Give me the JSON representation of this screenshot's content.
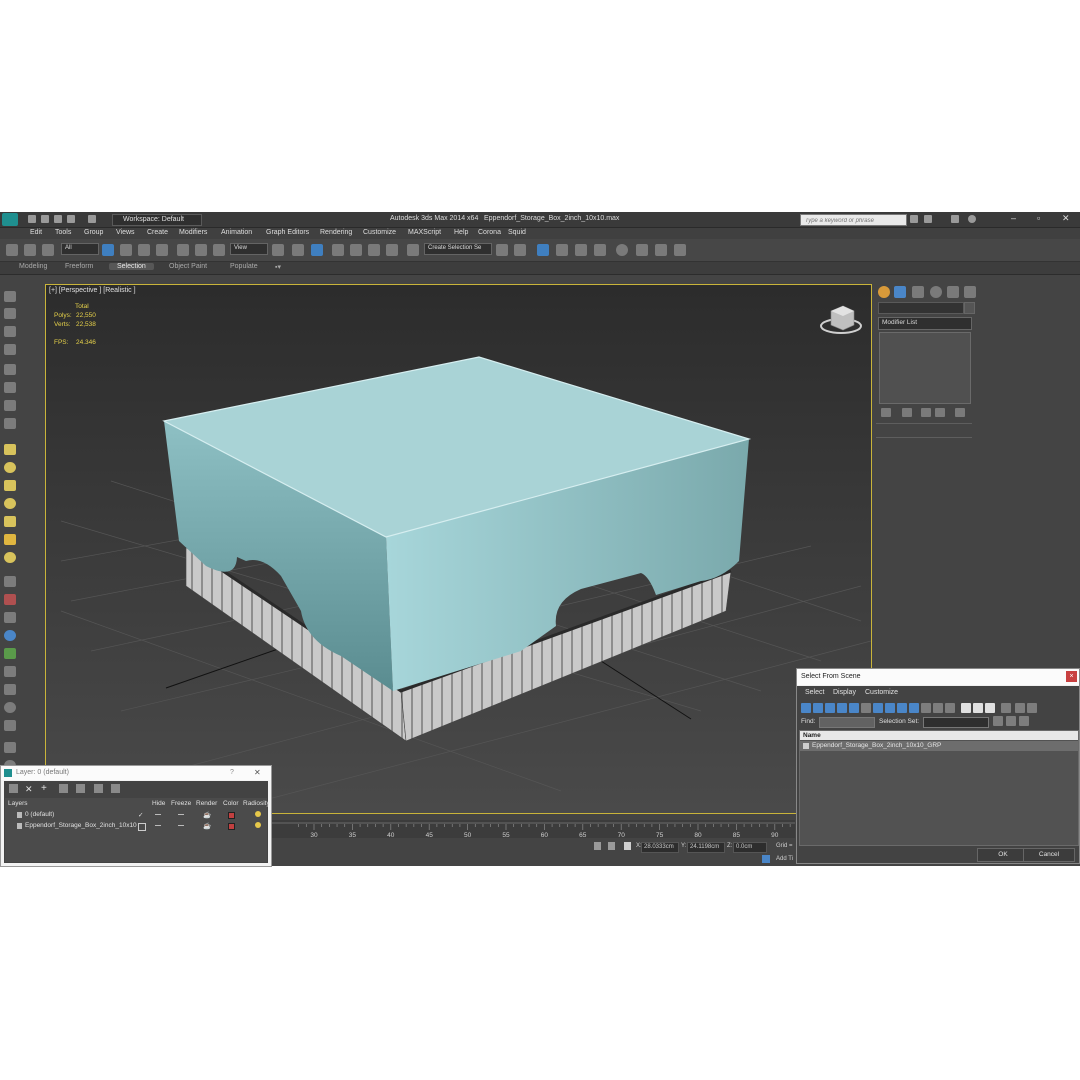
{
  "title_bar": {
    "workspace_label": "Workspace: Default",
    "app_title": "Autodesk 3ds Max  2014 x64",
    "file_name": "Eppendorf_Storage_Box_2inch_10x10.max",
    "search_placeholder": "Type a keyword or phrase"
  },
  "menu": [
    "Edit",
    "Tools",
    "Group",
    "Views",
    "Create",
    "Modifiers",
    "Animation",
    "Graph Editors",
    "Rendering",
    "Customize",
    "MAXScript",
    "Help",
    "Corona",
    "Squid"
  ],
  "toolbar": {
    "filter_dropdown": "All",
    "refcoord_dropdown": "View",
    "selection_set_dropdown": "Create Selection Se"
  },
  "ribbon_tabs": [
    "Modeling",
    "Freeform",
    "Selection",
    "Object Paint",
    "Populate"
  ],
  "ribbon_active": "Selection",
  "viewport": {
    "label": "[+] [Perspective ] [Realistic ]",
    "stats_header": "Total",
    "polys_label": "Polys:",
    "polys_value": "22,550",
    "verts_label": "Verts:",
    "verts_value": "22,538",
    "fps_label": "FPS:",
    "fps_value": "24.346"
  },
  "command_panel": {
    "modifier_list": "Modifier List"
  },
  "timeline": {
    "ticks": [
      "30",
      "35",
      "40",
      "45",
      "50",
      "55",
      "60",
      "65",
      "70",
      "75",
      "80",
      "85",
      "90"
    ]
  },
  "status": {
    "x_label": "X:",
    "x_value": "28.0333cm",
    "y_label": "Y:",
    "y_value": "24.1198cm",
    "z_label": "Z:",
    "z_value": "0.0cm",
    "grid_label": "Grid =",
    "add_label": "Add Ti"
  },
  "layer_dialog": {
    "title": "Layer: 0 (default)",
    "help": "?",
    "close": "✕",
    "columns": [
      "Layers",
      "Hide",
      "Freeze",
      "Render",
      "Color",
      "Radiosity"
    ],
    "rows": [
      {
        "name": "0 (default)"
      },
      {
        "name": "Eppendorf_Storage_Box_2inch_10x10"
      }
    ]
  },
  "select_dialog": {
    "title": "Select From Scene",
    "close": "×",
    "menus": [
      "Select",
      "Display",
      "Customize"
    ],
    "find_label": "Find:",
    "selection_set_label": "Selection Set:",
    "name_header": "Name",
    "items": [
      "Eppendorf_Storage_Box_2inch_10x10_GRP"
    ],
    "ok": "OK",
    "cancel": "Cancel"
  },
  "colors": {
    "lid": "#a9d3d6",
    "base": "#d0d0d0",
    "viewport_border": "#c9b43a",
    "stats": "#e6d14a"
  }
}
